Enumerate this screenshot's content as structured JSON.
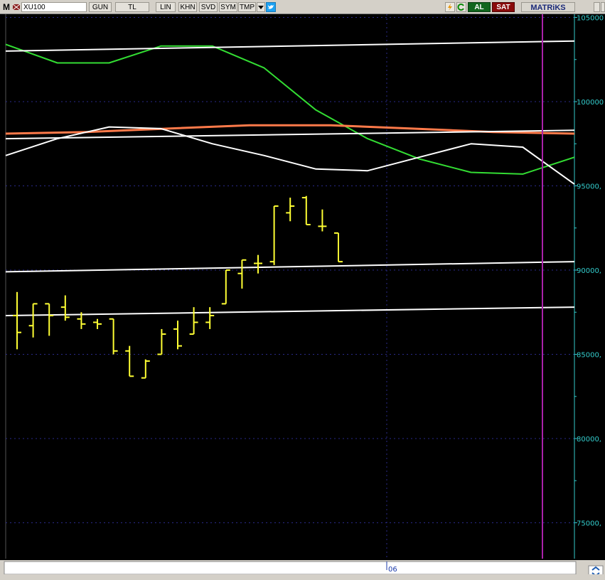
{
  "toolbar": {
    "menu": "M",
    "symbol": "XU100",
    "period": "GUN",
    "currency": "TL",
    "scale": "LIN",
    "khn": "KHN",
    "svd": "SVD",
    "sym": "SYM",
    "tmp": "TMP",
    "buy": "AL",
    "sell": "SAT",
    "brand": "MATRiKS"
  },
  "colors": {
    "background": "#000000",
    "bars": "#ffff33",
    "green_line": "#33dd33",
    "orange_line": "#ff7a4a",
    "white_line": "#ffffff",
    "cursor_line": "#aa22aa",
    "axis_text": "#33cccc"
  },
  "chart_data": {
    "type": "ohlc",
    "symbol": "XU100",
    "period": "GUN",
    "ylim": [
      72000,
      105200
    ],
    "y_ticks": [
      75000,
      80000,
      85000,
      90000,
      95000,
      100000,
      105000
    ],
    "y_tick_labels": [
      "75000,",
      "80000,",
      "85000,",
      "90000,",
      "95000,",
      "100000",
      "105000"
    ],
    "x_tick_label": "06",
    "x_tick_index": 23,
    "grid": "dashed",
    "ohlc": [
      {
        "o": 87300,
        "h": 88700,
        "l": 85300,
        "c": 86300
      },
      {
        "o": 86700,
        "h": 88000,
        "l": 86000,
        "c": 88000
      },
      {
        "o": 88000,
        "h": 88000,
        "l": 86100,
        "c": 87300
      },
      {
        "o": 87800,
        "h": 88500,
        "l": 87000,
        "c": 87200
      },
      {
        "o": 87100,
        "h": 87500,
        "l": 86500,
        "c": 86800
      },
      {
        "o": 86900,
        "h": 87100,
        "l": 86500,
        "c": 86800
      },
      {
        "o": 87100,
        "h": 87100,
        "l": 85000,
        "c": 85200
      },
      {
        "o": 85200,
        "h": 85500,
        "l": 83700,
        "c": 83700
      },
      {
        "o": 83600,
        "h": 84700,
        "l": 83600,
        "c": 84600
      },
      {
        "o": 85000,
        "h": 86500,
        "l": 85000,
        "c": 86200
      },
      {
        "o": 86500,
        "h": 87000,
        "l": 85300,
        "c": 85500
      },
      {
        "o": 86200,
        "h": 87800,
        "l": 86200,
        "c": 86900
      },
      {
        "o": 86900,
        "h": 87800,
        "l": 86500,
        "c": 87300
      },
      {
        "o": 88000,
        "h": 90000,
        "l": 88000,
        "c": 90000
      },
      {
        "o": 89800,
        "h": 90600,
        "l": 88900,
        "c": 90600
      },
      {
        "o": 90400,
        "h": 90900,
        "l": 89800,
        "c": 90400
      },
      {
        "o": 90500,
        "h": 93800,
        "l": 90300,
        "c": 93800
      },
      {
        "o": 93400,
        "h": 94300,
        "l": 92900,
        "c": 93800
      },
      {
        "o": 94300,
        "h": 94400,
        "l": 92700,
        "c": 92700
      },
      {
        "o": 92600,
        "h": 93600,
        "l": 92300,
        "c": 92600
      },
      {
        "o": 92200,
        "h": 92200,
        "l": 90500,
        "c": 90500
      }
    ],
    "lines": [
      {
        "color": "#33dd33",
        "values": [
          103400,
          102300,
          102300,
          103300,
          103300,
          102000,
          99500,
          97800,
          96600,
          95800,
          95700,
          96700
        ]
      },
      {
        "color": "#ff7a4a",
        "values": [
          98100,
          98200,
          98400,
          98600,
          98600,
          98400,
          98200,
          98100
        ]
      },
      {
        "color": "#ffffff",
        "values": [
          96800,
          97800,
          98500,
          98400,
          97500,
          96800,
          96000,
          95900,
          96700,
          97500,
          97300,
          95100
        ]
      },
      {
        "color": "#ffffff",
        "values": [
          103000,
          103600
        ]
      },
      {
        "color": "#ffffff",
        "values": [
          97800,
          98300
        ]
      },
      {
        "color": "#ffffff",
        "values": [
          89900,
          90500
        ]
      },
      {
        "color": "#ffffff",
        "values": [
          87300,
          87800
        ]
      }
    ]
  }
}
